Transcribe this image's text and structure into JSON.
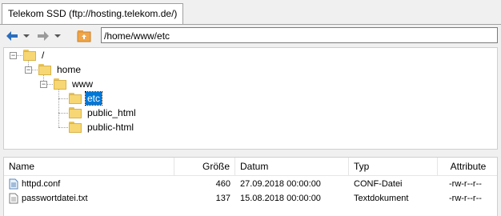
{
  "tab": {
    "title": "Telekom SSD (ftp://hosting.telekom.de/)"
  },
  "toolbar": {
    "back_icon": "back-arrow-icon",
    "forward_icon": "forward-arrow-icon",
    "up_icon": "parent-folder-icon",
    "address": "/home/www/etc"
  },
  "tree": {
    "nodes": [
      {
        "label": "/"
      },
      {
        "label": "home"
      },
      {
        "label": "www"
      },
      {
        "label": "etc",
        "selected": true
      },
      {
        "label": "public_html"
      },
      {
        "label": "public-html"
      }
    ]
  },
  "list": {
    "columns": {
      "name": "Name",
      "size": "Größe",
      "date": "Datum",
      "type": "Typ",
      "attr": "Attribute"
    },
    "rows": [
      {
        "name": "httpd.conf",
        "size": "460",
        "date": "27.09.2018 00:00:00",
        "type": "CONF-Datei",
        "attr": "-rw-r--r--"
      },
      {
        "name": "passwortdatei.txt",
        "size": "137",
        "date": "15.08.2018 00:00:00",
        "type": "Textdokument",
        "attr": "-rw-r--r--"
      }
    ]
  },
  "colors": {
    "accent": "#0078d7",
    "folder": "#f7d774",
    "back_arrow": "#2a6fbf"
  }
}
